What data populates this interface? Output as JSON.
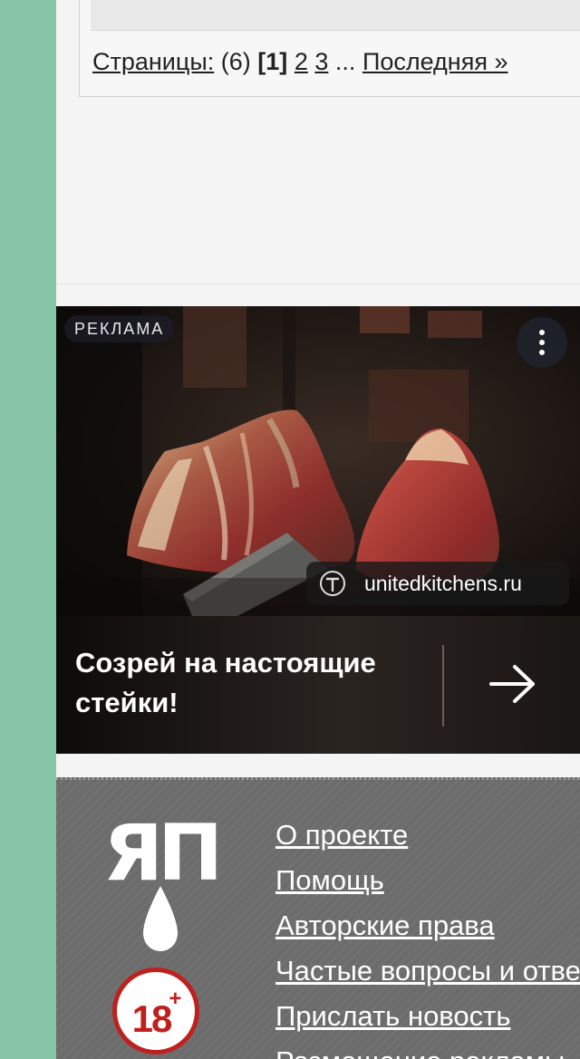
{
  "pagination": {
    "label": "Страницы:",
    "total": "(6)",
    "current": "[1]",
    "pages": [
      "2",
      "3"
    ],
    "ellipsis": "...",
    "last": "Последняя »"
  },
  "ad": {
    "badge": "РЕКЛАМА",
    "domain": "unitedkitchens.ru",
    "headline": "Созрей на настоящие стейки!",
    "menu_icon": "more-vertical-icon",
    "arrow_icon": "arrow-right-icon"
  },
  "footer": {
    "logo_text": "ЯП",
    "age_rating": "18",
    "age_plus": "+",
    "links": [
      "О проекте",
      "Помощь",
      "Авторские права",
      "Частые вопросы и ответы",
      "Прислать новость",
      "Размещение рекламы"
    ]
  },
  "colors": {
    "sidebar": "#86c5a5",
    "footer_bg": "#6c6c6c",
    "age_badge": "#c0201d",
    "pager_accent": "#2a66b8"
  }
}
